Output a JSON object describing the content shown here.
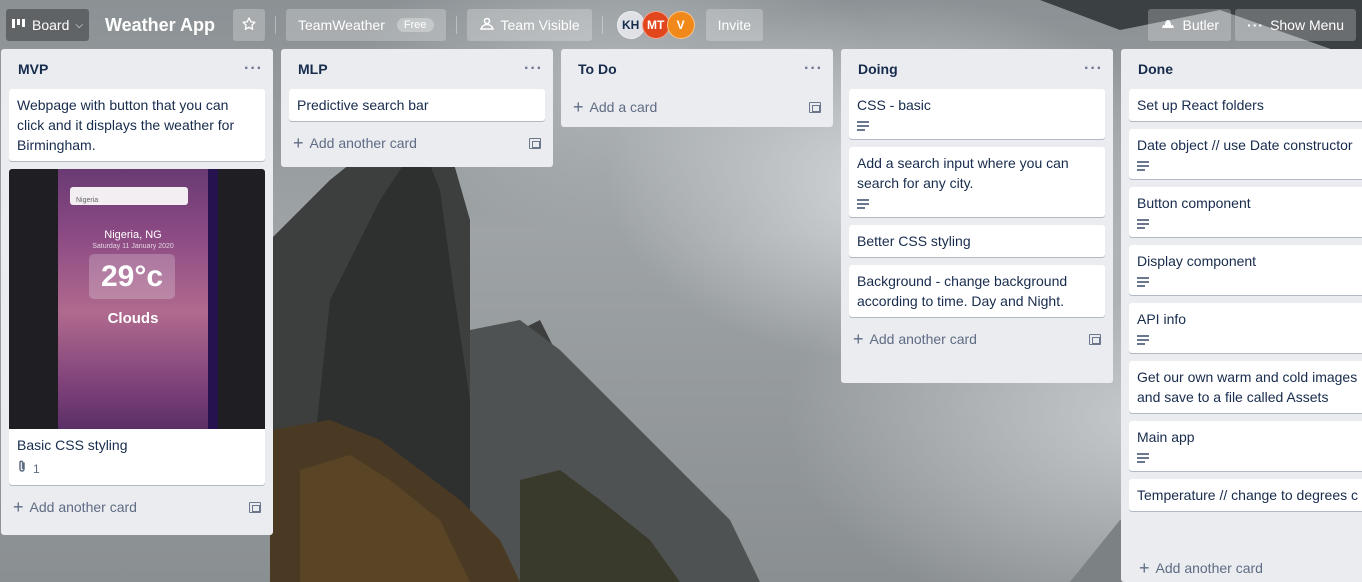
{
  "header": {
    "board_switcher_label": "Board",
    "board_title": "Weather App",
    "team_name": "TeamWeather",
    "team_plan_badge": "Free",
    "visibility_label": "Team Visible",
    "members": [
      {
        "initials": "KH",
        "color": "#dfe1e6",
        "text_color": "#172b4d"
      },
      {
        "initials": "MT",
        "color": "#e2461d",
        "text_color": "#ffffff"
      },
      {
        "initials": "V",
        "color": "#f0891a",
        "text_color": "#ffffff"
      }
    ],
    "invite_label": "Invite",
    "butler_label": "Butler",
    "show_menu_label": "Show Menu"
  },
  "lists": [
    {
      "title": "MVP",
      "cards": [
        {
          "text": "Webpage with button that you can click and it displays the weather for Birmingham."
        },
        {
          "text": "Basic CSS styling",
          "attachments": "1",
          "cover": {
            "search_text": "Nigeria",
            "city": "Nigeria, NG",
            "date": "Saturday 11 January 2020",
            "temp": "29°c",
            "condition": "Clouds"
          }
        }
      ],
      "add_label": "Add another card"
    },
    {
      "title": "MLP",
      "cards": [
        {
          "text": "Predictive search bar"
        }
      ],
      "add_label": "Add another card"
    },
    {
      "title": "To Do",
      "cards": [],
      "add_label": "Add a card"
    },
    {
      "title": "Doing",
      "cards": [
        {
          "text": "CSS - basic",
          "has_description": true
        },
        {
          "text": "Add a search input where you can search for any city.",
          "has_description": true
        },
        {
          "text": "Better CSS styling"
        },
        {
          "text": "Background - change background according to time. Day and Night."
        }
      ],
      "add_label": "Add another card"
    },
    {
      "title": "Done",
      "cards": [
        {
          "text": "Set up React folders"
        },
        {
          "text": "Date object // use Date constructor",
          "has_description": true
        },
        {
          "text": "Button component",
          "has_description": true
        },
        {
          "text": "Display component",
          "has_description": true
        },
        {
          "text": "API info",
          "has_description": true
        },
        {
          "text": "Get our own warm and cold images and save to a file called Assets"
        },
        {
          "text": "Main app",
          "has_description": true
        },
        {
          "text": "Temperature // change to degrees c"
        }
      ],
      "add_label": "Add another card"
    }
  ]
}
